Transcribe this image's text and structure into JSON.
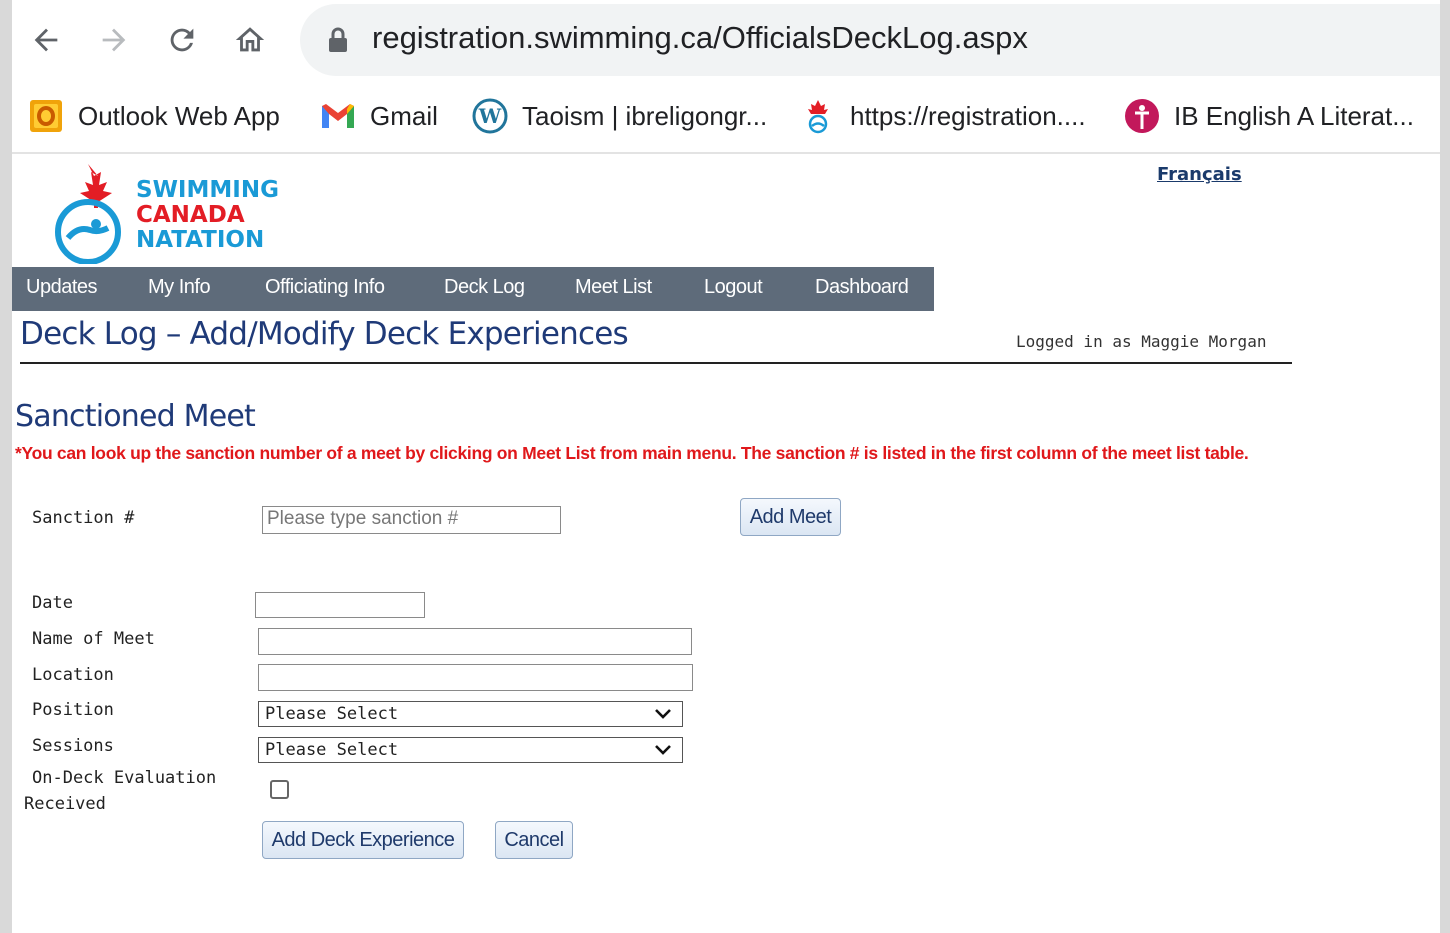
{
  "browser": {
    "url": "registration.swimming.ca/OfficialsDeckLog.aspx",
    "nav_icons": [
      "back-arrow-icon",
      "forward-arrow-icon",
      "reload-icon",
      "home-icon"
    ],
    "bookmarks": [
      {
        "label": "Outlook Web App",
        "icon": "outlook-icon"
      },
      {
        "label": "Gmail",
        "icon": "gmail-icon"
      },
      {
        "label": "Taoism | ibreligongr...",
        "icon": "wordpress-icon"
      },
      {
        "label": "https://registration....",
        "icon": "swimming-canada-icon"
      },
      {
        "label": "IB English A Literat...",
        "icon": "pin-icon"
      }
    ]
  },
  "site": {
    "logo_lines": [
      "SWIMMING",
      "CANADA",
      "NATATION"
    ],
    "language_link": "Français",
    "colors": {
      "nav_bg": "#5e6b7a",
      "heading": "#1f3a78",
      "notice": "#e0181b",
      "logo_red": "#e31d25",
      "logo_blue": "#1a9ad6"
    }
  },
  "nav": {
    "items": [
      "Updates",
      "My Info",
      "Officiating Info",
      "Deck Log",
      "Meet List",
      "Logout",
      "Dashboard"
    ]
  },
  "header": {
    "title": "Deck Log – Add/Modify Deck Experiences",
    "logged_in": "Logged in as Maggie Morgan"
  },
  "section": {
    "title": "Sanctioned Meet",
    "notice": "*You can look up the sanction number of a meet by clicking on Meet List from main menu. The sanction # is listed in the first column of the meet list table."
  },
  "form": {
    "sanction_label": "Sanction #",
    "sanction_placeholder": "Please type sanction #",
    "add_meet_label": "Add Meet",
    "date_label": "Date",
    "date_value": "",
    "meet_name_label": "Name of Meet",
    "meet_name_value": "",
    "location_label": "Location",
    "location_value": "",
    "position_label": "Position",
    "position_value": "Please Select",
    "sessions_label": "Sessions",
    "sessions_value": "Please Select",
    "evaluation_label_1": "On-Deck Evaluation",
    "evaluation_label_2": "Received",
    "evaluation_checked": false,
    "add_experience_label": "Add Deck Experience",
    "cancel_label": "Cancel"
  }
}
